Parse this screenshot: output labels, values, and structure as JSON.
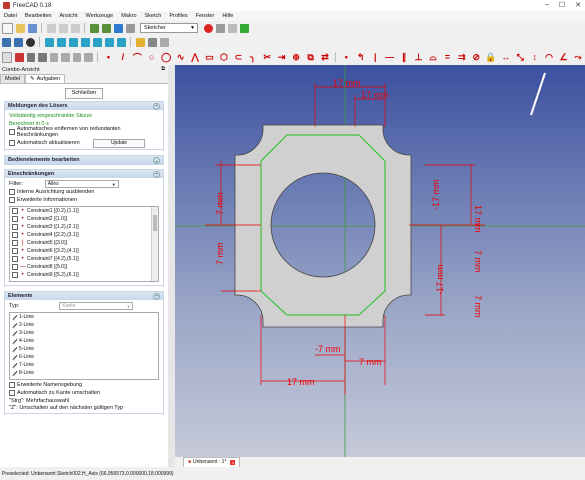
{
  "window": {
    "title": "FreeCAD 0.18"
  },
  "menu": [
    "Datei",
    "Bearbeiten",
    "Ansicht",
    "Werkzeuge",
    "Makro",
    "Sketch",
    "Profiles",
    "Fenster",
    "Hilfe"
  ],
  "workbench": {
    "selected": "Sketcher"
  },
  "combo": {
    "title": "Combo-Ansicht",
    "tabs": [
      "Model",
      "Aufgaben"
    ],
    "close_label": "Schließen"
  },
  "solver": {
    "header": "Meldungen des Lösers",
    "status": "Vollständig eingeschränkte Skizze",
    "time": "Berechnet in 0 s",
    "remove_redundant": "Automatisches entfernen von redundanten Beschränkungen",
    "auto_update": "Automatisch aktualisieren",
    "update_label": "Update"
  },
  "edit_controls": {
    "header": "Bedienelemente bearbeiten"
  },
  "constraints": {
    "header": "Einschränkungen",
    "filter_label": "Filter:",
    "filter_value": "Alles",
    "hide_internal": "Interne Ausrichtung ausblenden",
    "extended_info": "Erweiterte Informationen",
    "items": [
      {
        "mark": "•",
        "label": "Constraint1 [(0.2),(1.1)]"
      },
      {
        "mark": "•",
        "label": "Constraint2 [(1.0)]"
      },
      {
        "mark": "•",
        "label": "Constraint3 [(1.2),(2.1)]"
      },
      {
        "mark": "•",
        "label": "Constraint4 [(2.2),(3.1)]"
      },
      {
        "mark": "|",
        "label": "Constraint5 [(3.0)]"
      },
      {
        "mark": "•",
        "label": "Constraint6 [(3.2),(4.1)]"
      },
      {
        "mark": "•",
        "label": "Constraint7 [(4.2),(5.1)]"
      },
      {
        "mark": "—",
        "label": "Constraint8 [(5.0)]"
      },
      {
        "mark": "•",
        "label": "Constraint9 [(5.2),(6.1)]"
      }
    ]
  },
  "elements": {
    "header": "Elemente",
    "type_label": "Typ:",
    "type_value": "Kante",
    "items": [
      "1-Linie",
      "2-Linie",
      "3-Linie",
      "4-Linie",
      "5-Linie",
      "6-Linie",
      "7-Linie",
      "8-Linie"
    ],
    "extended_naming": "Erweiterte Namensgebung",
    "auto_switch": "Automatisch zu Kante umschalten",
    "hint1": "\"Strg\": Mehrfachauswahl",
    "hint2": "\"Z\": Umschalten auf den nächsten gültigen Typ"
  },
  "view_tab": {
    "label": "Unbenannt : 1*"
  },
  "dimensions": [
    "17 mm",
    "17 mm",
    "7 mm",
    "7 mm",
    "-17 mm",
    "-7 mm",
    "17 mm",
    "7 mm",
    "-17 mm",
    "7 mm",
    "17 mm",
    "7 mm"
  ],
  "statusbar": {
    "text": "Preselected: Unbenannt.Sketch002.H_Axis (66.956573,0.000000,18.000999)"
  },
  "colors": {
    "dim": "#e00000",
    "face": "#d0d0d0",
    "selection": "#20c020",
    "axis": "#40a040"
  }
}
